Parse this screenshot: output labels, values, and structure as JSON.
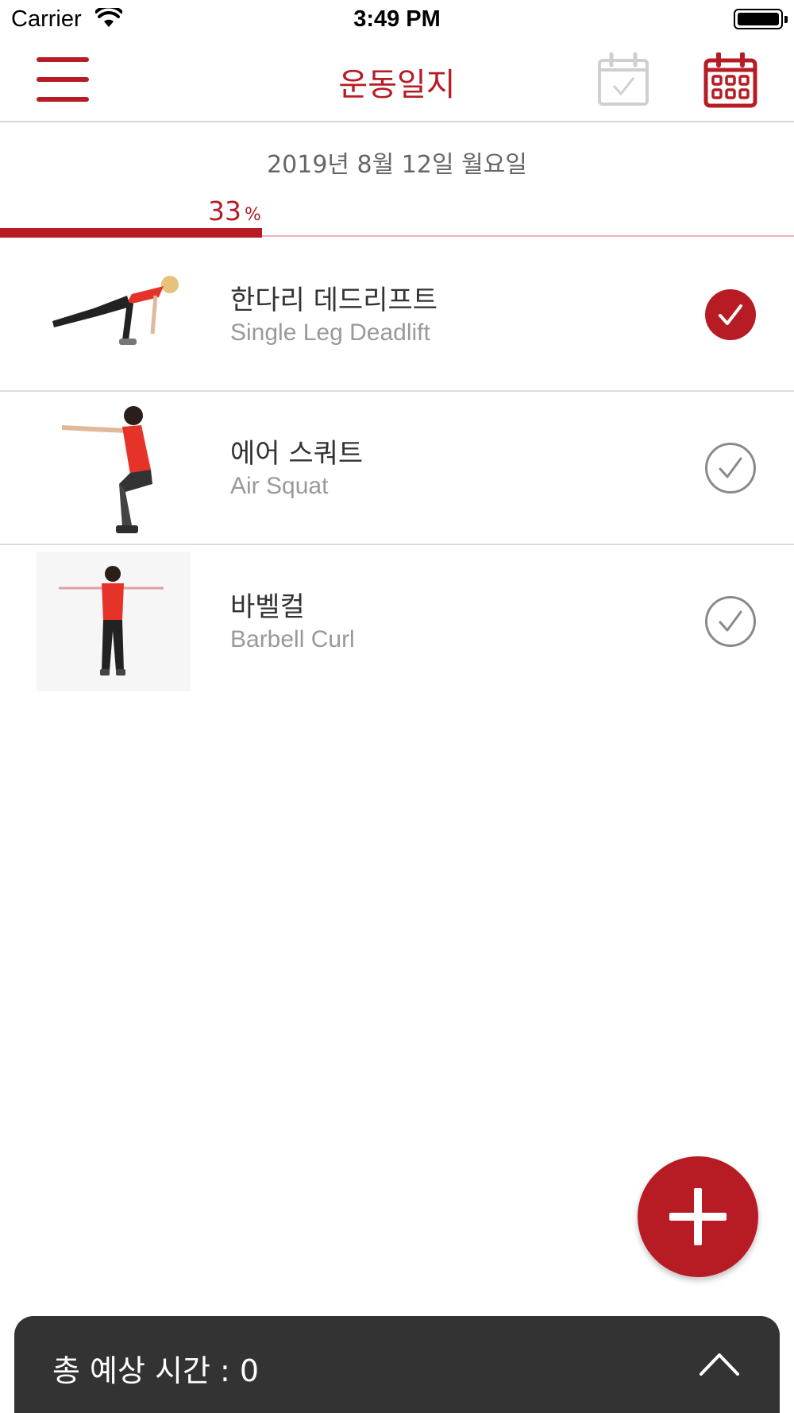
{
  "status_bar": {
    "carrier": "Carrier",
    "time": "3:49 PM"
  },
  "nav": {
    "title": "운동일지",
    "menu_icon": "hamburger-icon",
    "calendar_check_icon": "calendar-check-icon",
    "calendar_grid_icon": "calendar-grid-icon"
  },
  "date": "2019년 8월 12일 월요일",
  "progress": {
    "value": "33",
    "unit": "%",
    "fraction": 0.33
  },
  "exercises": [
    {
      "name_ko": "한다리 데드리프트",
      "name_en": "Single Leg Deadlift",
      "done": true
    },
    {
      "name_ko": "에어 스쿼트",
      "name_en": "Air Squat",
      "done": false
    },
    {
      "name_ko": "바벨컬",
      "name_en": "Barbell Curl",
      "done": false
    }
  ],
  "fab_icon": "plus-icon",
  "bottom_panel": {
    "label": "총 예상 시간 : 0",
    "icon": "chevron-up-icon"
  },
  "colors": {
    "accent": "#b71c25",
    "panel": "#333333",
    "muted": "#999999"
  }
}
